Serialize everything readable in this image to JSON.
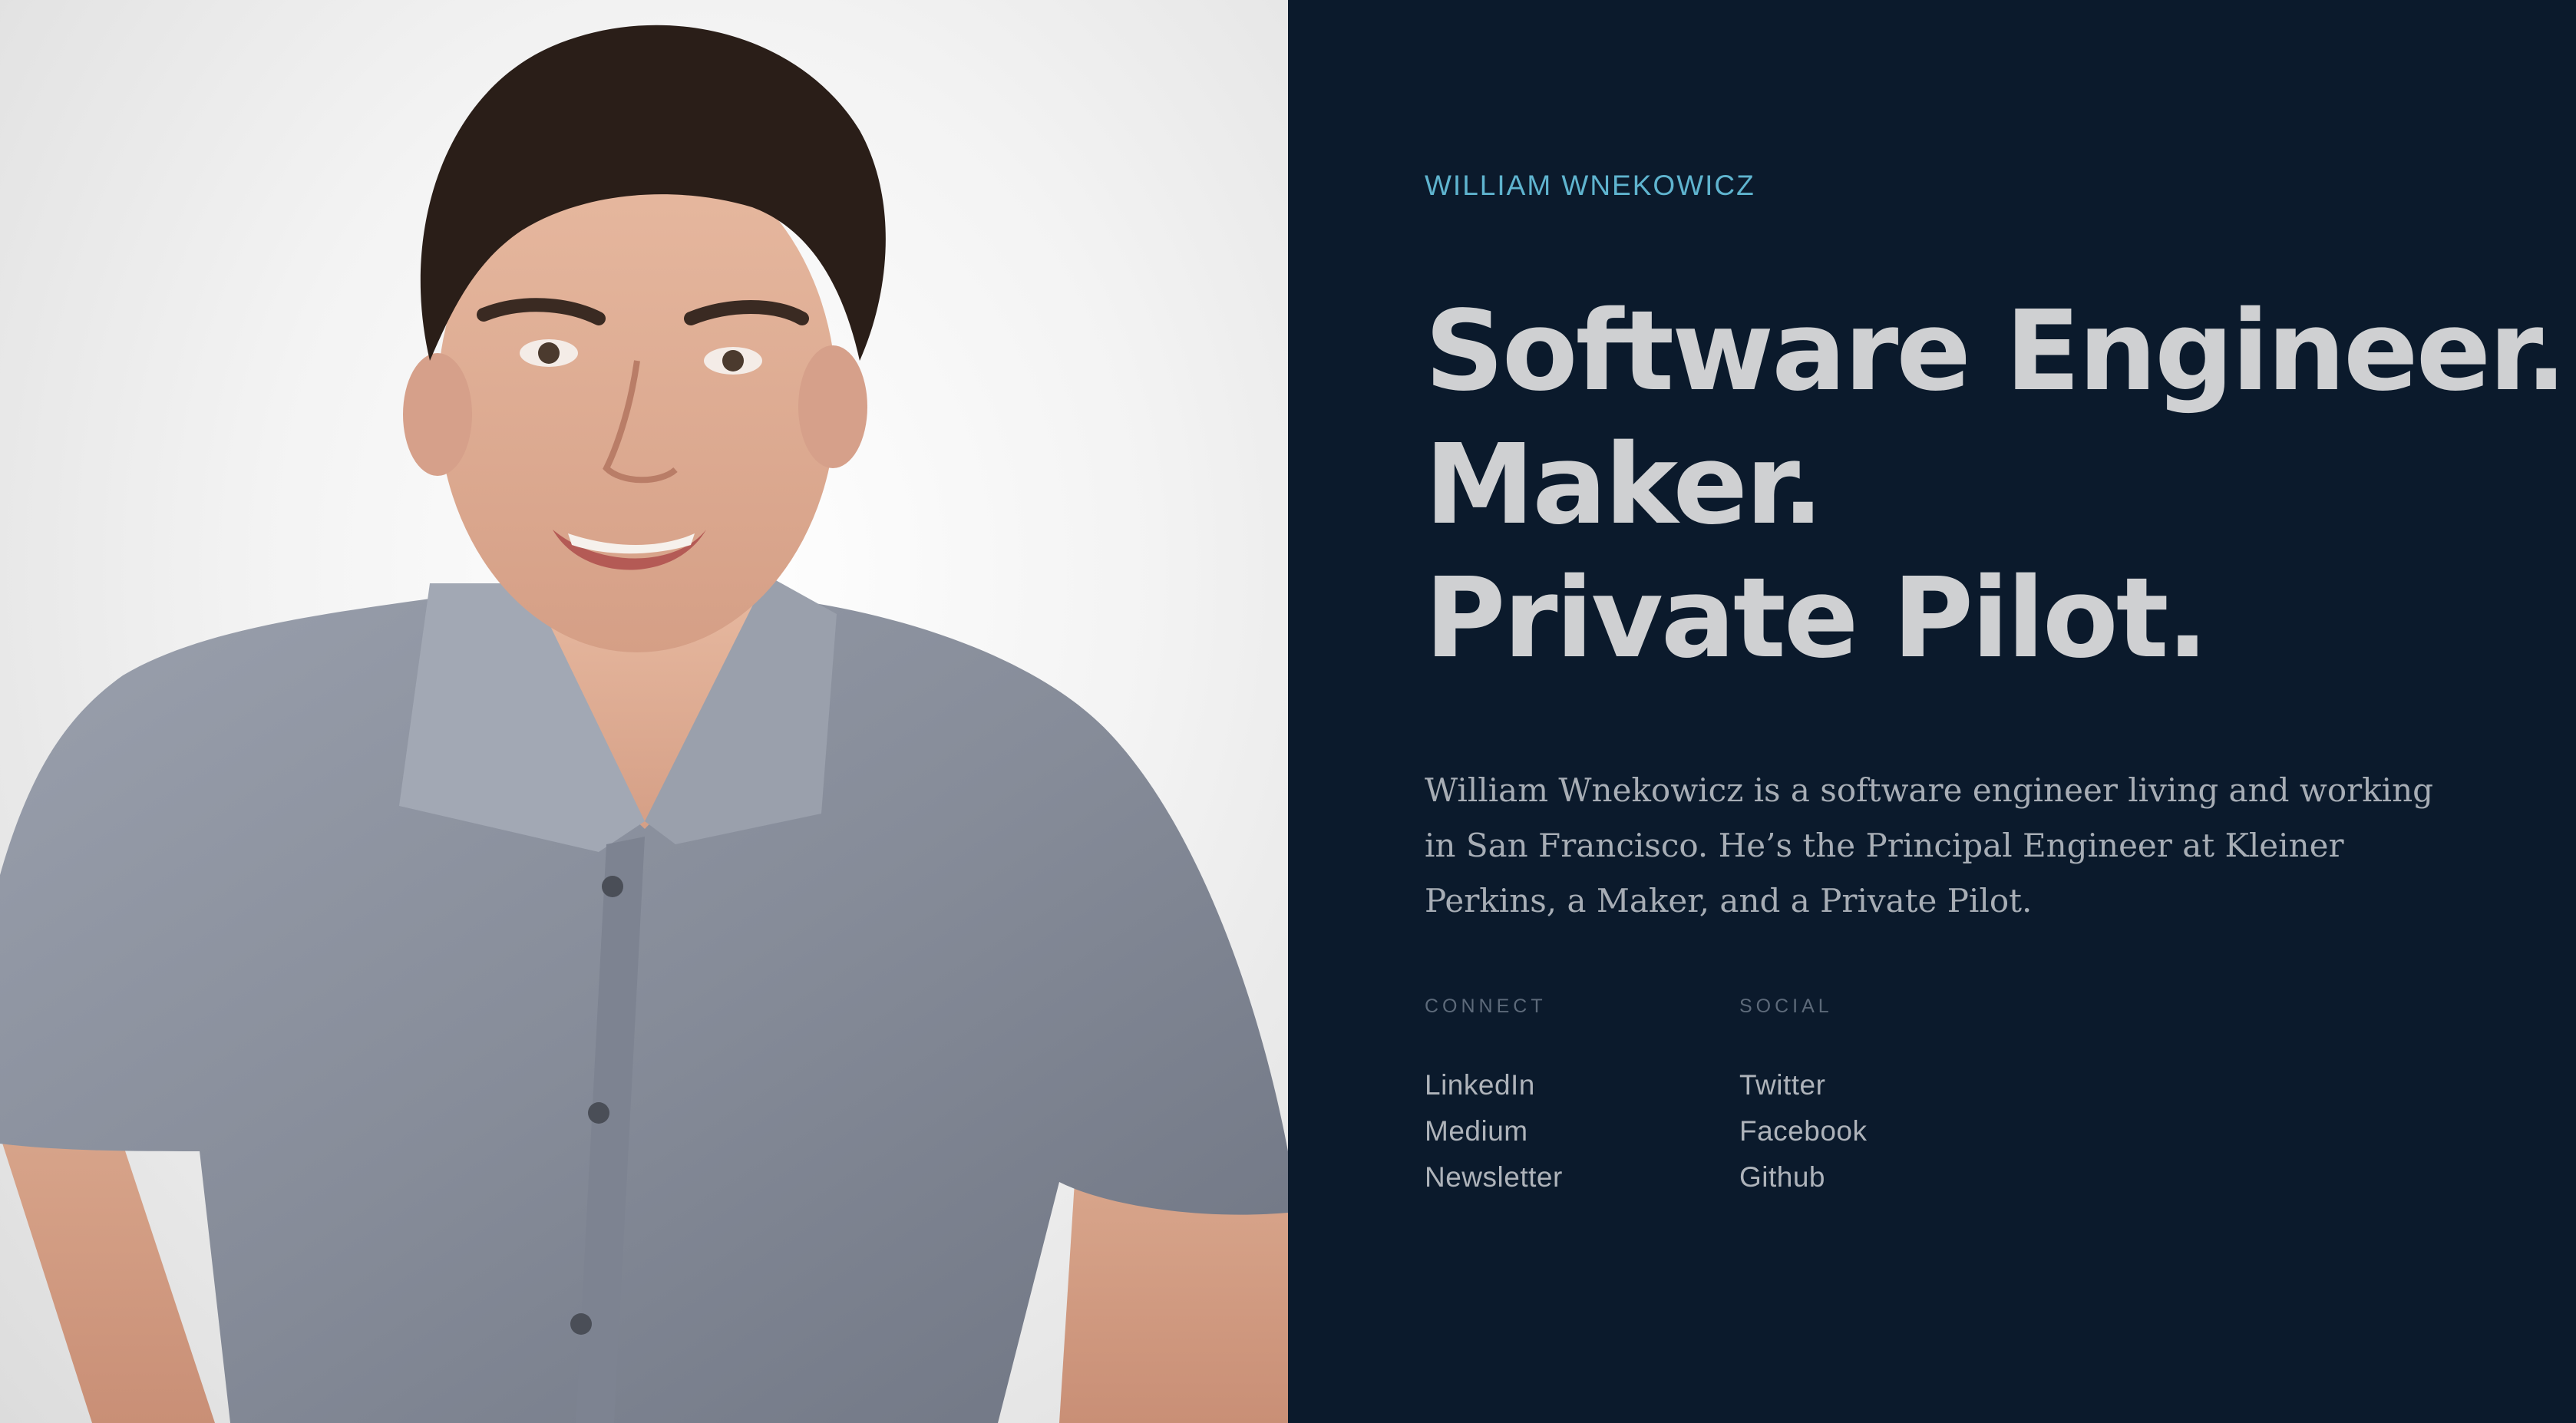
{
  "profile": {
    "name": "WILLIAM WNEKOWICZ",
    "headline_lines": [
      "Software Engineer.",
      "Maker.",
      "Private Pilot."
    ],
    "bio": "William Wnekowicz is a software engineer living and working in San Francisco. He’s the Principal Engineer at Kleiner Perkins, a Maker, and a Private Pilot."
  },
  "links": {
    "connect": {
      "heading": "CONNECT",
      "items": [
        "LinkedIn",
        "Medium",
        "Newsletter"
      ]
    },
    "social": {
      "heading": "SOCIAL",
      "items": [
        "Twitter",
        "Facebook",
        "Github"
      ]
    }
  },
  "photo": {
    "subject": "portrait photo of a smiling man in a grey button-up shirt"
  },
  "colors": {
    "background": "#0b1a2c",
    "accent": "#5fb4cf",
    "headline": "#cfd0d2",
    "body_text": "#a7adb5"
  }
}
